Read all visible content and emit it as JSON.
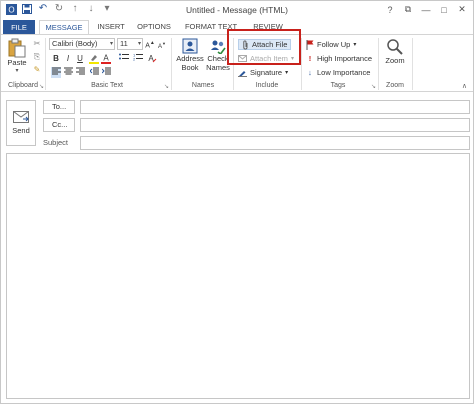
{
  "window": {
    "title": "Untitled - Message (HTML)",
    "controls": {
      "help": "?",
      "restore": "⧉",
      "minimize": "—",
      "maximize": "□",
      "close": "✕"
    }
  },
  "tabs": [
    {
      "label": "FILE"
    },
    {
      "label": "MESSAGE"
    },
    {
      "label": "INSERT"
    },
    {
      "label": "OPTIONS"
    },
    {
      "label": "FORMAT TEXT"
    },
    {
      "label": "REVIEW"
    }
  ],
  "ribbon": {
    "clipboard": {
      "paste": "Paste",
      "group": "Clipboard"
    },
    "basic_text": {
      "font": "Calibri (Body)",
      "size": "11",
      "bold": "B",
      "italic": "I",
      "underline": "U",
      "group": "Basic Text"
    },
    "names": {
      "address_book": "Address Book",
      "check_names": "Check Names",
      "group": "Names"
    },
    "include": {
      "attach_file": "Attach File",
      "attach_item": "Attach Item",
      "signature": "Signature",
      "group": "Include"
    },
    "tags": {
      "follow_up": "Follow Up",
      "high_importance": "High Importance",
      "low_importance": "Low Importance",
      "group": "Tags"
    },
    "zoom": {
      "zoom": "Zoom",
      "group": "Zoom"
    }
  },
  "compose": {
    "send": "Send",
    "to": "To...",
    "cc": "Cc...",
    "subject": "Subject",
    "to_value": "",
    "cc_value": "",
    "subject_value": "",
    "body": ""
  },
  "colors": {
    "accent": "#2b579a",
    "highlight": "#c8211b",
    "flag": "#c8211b"
  }
}
